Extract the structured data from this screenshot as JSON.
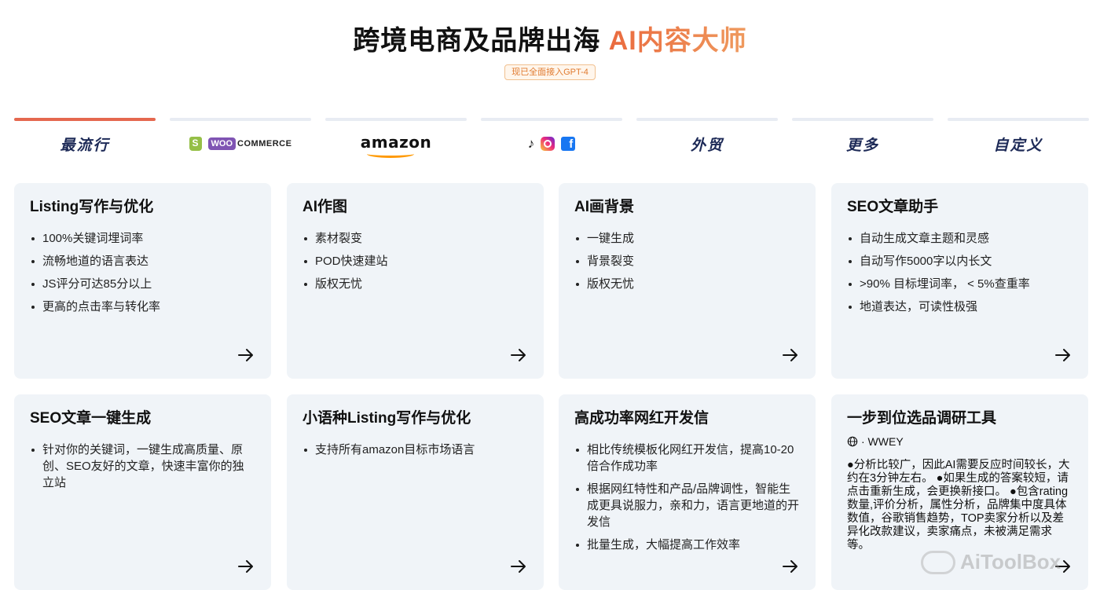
{
  "hero": {
    "title_main": "跨境电商及品牌出海 ",
    "title_accent": "AI内容大师",
    "badge": "现已全面接入GPT-4"
  },
  "tabs": [
    {
      "label": "最流行",
      "active": true
    },
    {
      "label": "WOO COMMERCE",
      "icon": "shopify-woocommerce-logo"
    },
    {
      "label": "amazon",
      "icon": "amazon-logo"
    },
    {
      "label": "",
      "icon": "tiktok-instagram-facebook-icons"
    },
    {
      "label": "外贸"
    },
    {
      "label": "更多"
    },
    {
      "label": "自定义"
    }
  ],
  "woo": {
    "pill": "WOO",
    "word": "COMMERCE"
  },
  "amazon": {
    "word": "amazon"
  },
  "cards": [
    {
      "title": "Listing写作与优化",
      "items": [
        "100%关键词埋词率",
        "流畅地道的语言表达",
        "JS评分可达85分以上",
        "更高的点击率与转化率"
      ]
    },
    {
      "title": "AI作图",
      "items": [
        "素材裂变",
        "POD快速建站",
        "版权无忧"
      ]
    },
    {
      "title": "AI画背景",
      "items": [
        "一键生成",
        "背景裂变",
        "版权无忧"
      ]
    },
    {
      "title": "SEO文章助手",
      "items": [
        "自动生成文章主题和灵感",
        "自动写作5000字以内长文",
        ">90% 目标埋词率， < 5%查重率",
        "地道表达，可读性极强"
      ]
    },
    {
      "title": "SEO文章一键生成",
      "items": [
        "针对你的关键词，一键生成高质量、原创、SEO友好的文章，快速丰富你的独立站"
      ]
    },
    {
      "title": "小语种Listing写作与优化",
      "items": [
        "支持所有amazon目标市场语言"
      ]
    },
    {
      "title": "高成功率网红开发信",
      "items": [
        "相比传统模板化网红开发信，提高10-20倍合作成功率",
        "根据网红特性和产品/品牌调性，智能生成更具说服力，亲和力，语言更地道的开发信",
        "批量生成，大幅提高工作效率"
      ]
    },
    {
      "title": "一步到位选品调研工具",
      "author": "· WWEY",
      "description": "●分析比较广，因此AI需要反应时间较长，大约在3分钟左右。 ●如果生成的答案较短，请点击重新生成，会更换新接口。 ●包含rating数量,评价分析，属性分析，品牌集中度具体数值，谷歌销售趋势，TOP卖家分析以及差异化改款建议，卖家痛点，未被满足需求等。"
    }
  ],
  "watermark": "AiToolBox",
  "colors": {
    "accent": "#e5684f",
    "card_bg": "#f0f4f8",
    "tab_text": "#1d2a57",
    "badge": "#e07a2f"
  }
}
